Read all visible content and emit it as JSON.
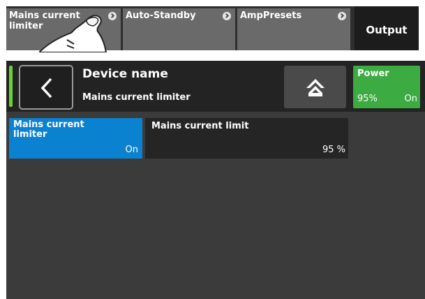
{
  "tabs": [
    {
      "label": "Mains current limiter"
    },
    {
      "label": "Auto-Standby"
    },
    {
      "label": "AmpPresets"
    }
  ],
  "output_tab": {
    "label": "Output"
  },
  "header": {
    "device_name": "Device name",
    "subtitle": "Mains current limiter"
  },
  "power": {
    "title": "Power",
    "value": "95%",
    "state": "On"
  },
  "tiles": {
    "limiter": {
      "label": "Mains current limiter",
      "state": "On"
    },
    "limit": {
      "label": "Mains current limit",
      "value": "95 %"
    }
  },
  "colors": {
    "accent_blue": "#0a82d0",
    "power_green": "#3cab41",
    "indicator_green": "#6cd23a"
  },
  "icons": [
    "chevron-right-icon",
    "back-arrow-icon",
    "home-icon",
    "hand-pointer-icon"
  ]
}
